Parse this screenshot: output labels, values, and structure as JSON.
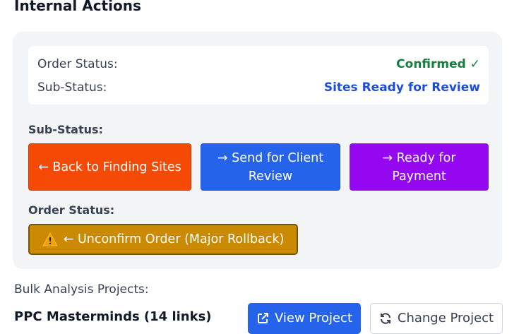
{
  "section": {
    "title": "Internal Actions"
  },
  "status_box": {
    "order_status_label": "Order Status:",
    "order_status_value": "Confirmed ✓",
    "sub_status_label": "Sub-Status:",
    "sub_status_value": "Sites Ready for Review"
  },
  "sub_status_group": {
    "label": "Sub-Status:",
    "buttons": [
      {
        "label": "← Back to Finding Sites",
        "color": "#f54a05"
      },
      {
        "label": "→ Send for Client Review",
        "color": "#2563eb"
      },
      {
        "label": "→ Ready for Payment",
        "color": "#9407f0"
      }
    ]
  },
  "order_status_group": {
    "label": "Order Status:",
    "unconfirm_button": {
      "label": "← Unconfirm Order (Major Rollback)",
      "icon": "warning-icon",
      "color": "#ca8a04"
    }
  },
  "bulk": {
    "label": "Bulk Analysis Projects:",
    "project_name": "PPC Masterminds (14 links)",
    "view_button": {
      "label": "View Project",
      "icon": "external-link-icon"
    },
    "change_button": {
      "label": "Change Project",
      "icon": "refresh-icon"
    }
  }
}
